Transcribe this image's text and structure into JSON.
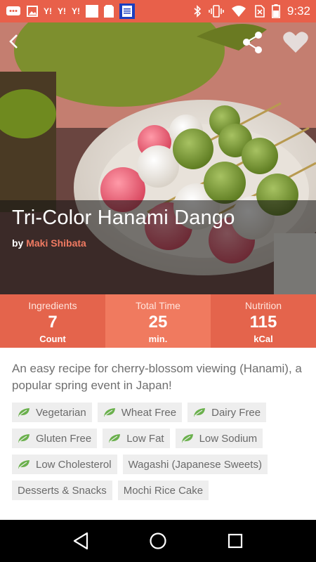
{
  "status_bar": {
    "time": "9:32",
    "yahoo_label": "Y!",
    "notification_icons": [
      "messages-icon",
      "image-icon",
      "yahoo-icon",
      "yahoo-icon",
      "yahoo-icon",
      "blank-icon",
      "clipboard-icon",
      "calendar-icon"
    ],
    "system_icons": [
      "bluetooth-icon",
      "vibrate-icon",
      "wifi-icon",
      "no-sim-icon",
      "battery-icon"
    ]
  },
  "hero": {
    "title": "Tri-Color Hanami Dango",
    "by_prefix": "by",
    "author": "Maki Shibata"
  },
  "stats": [
    {
      "label": "Ingredients",
      "value": "7",
      "unit": "Count"
    },
    {
      "label": "Total Time",
      "value": "25",
      "unit": "min."
    },
    {
      "label": "Nutrition",
      "value": "115",
      "unit": "kCal"
    }
  ],
  "description": "An easy recipe for cherry-blossom viewing (Hanami), a popular spring event in Japan!",
  "diet_tags": [
    "Vegetarian",
    "Wheat Free",
    "Dairy Free",
    "Gluten Free",
    "Low Fat",
    "Low Sodium",
    "Low Cholesterol"
  ],
  "category_tags": [
    "Wagashi (Japanese Sweets)",
    "Desserts & Snacks",
    "Mochi Rice Cake"
  ],
  "colors": {
    "accent": "#e8604a",
    "stat_dark": "#e4644c",
    "stat_light": "#f07a5f",
    "leaf_green": "#6ab04c",
    "author": "#f07a62"
  }
}
